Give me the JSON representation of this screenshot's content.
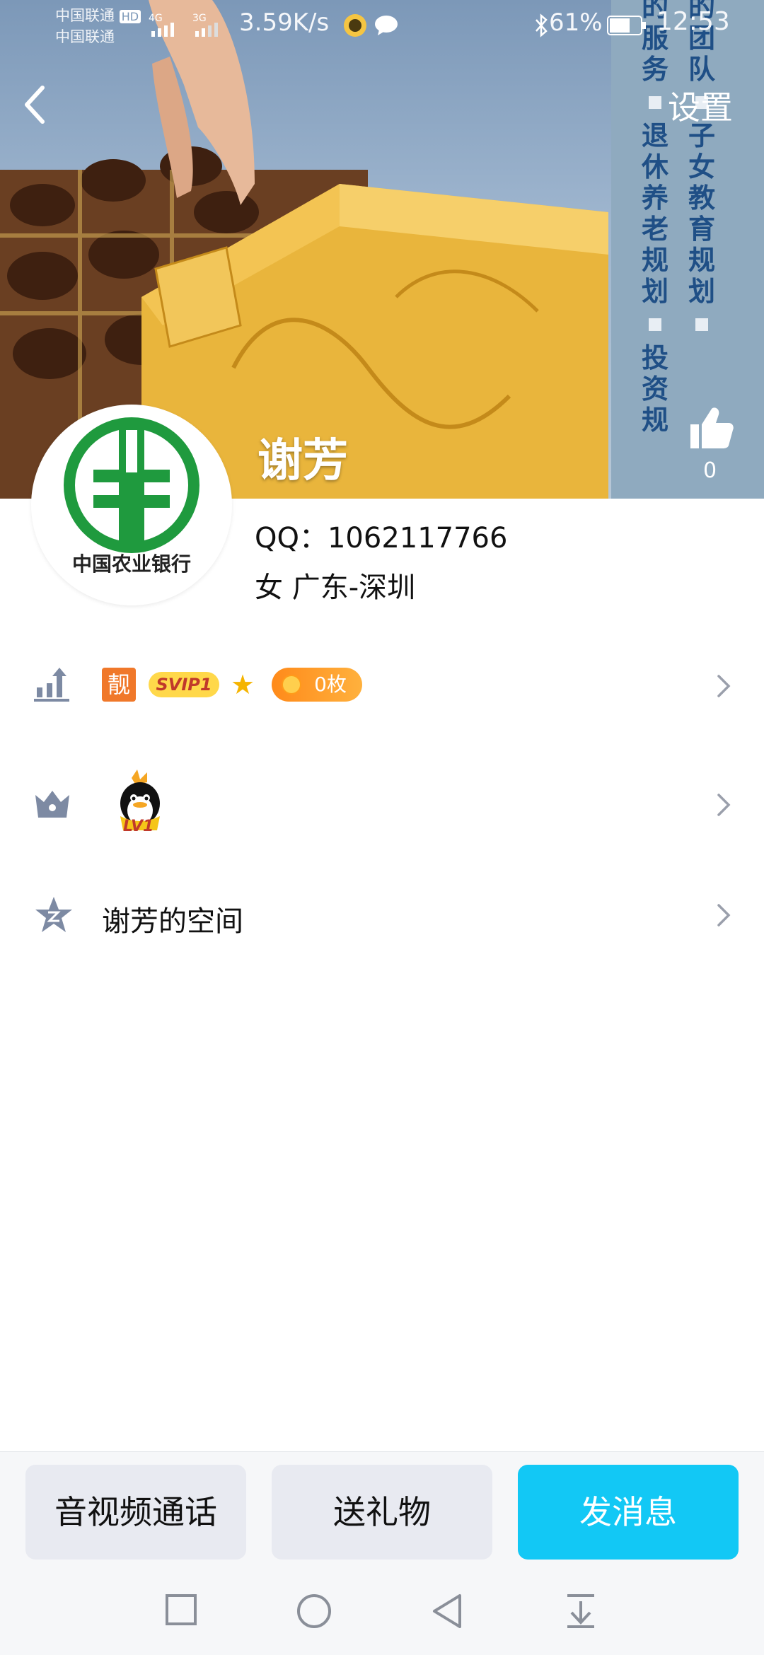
{
  "status_bar": {
    "carrier_1": "中国联通",
    "carrier_2": "中国联通",
    "hd_label": "HD",
    "net_1": "4G",
    "net_2": "3G",
    "speed": "3.59K/s",
    "battery": "61%",
    "time": "12:53"
  },
  "header": {
    "back_icon": "chevron-left-icon",
    "settings_label": "设置",
    "like_count": "0",
    "banner_columns": [
      {
        "top": "的服务",
        "bottom": "退休养老规划",
        "tail": "投资规"
      },
      {
        "top": "的团队",
        "bottom": "子女教育规划",
        "tail": ""
      }
    ]
  },
  "profile": {
    "name": "谢芳",
    "qq": "QQ：1062117766",
    "gender_location": "女  广东-深圳",
    "avatar_text": "中国农业银行"
  },
  "rows": [
    {
      "icon": "level-up-icon",
      "badges": {
        "liang": "靓",
        "svip": "SVIP1",
        "coin": "0枚"
      }
    },
    {
      "icon": "crown-icon",
      "badge_text": "LV1"
    },
    {
      "icon": "qzone-star-icon",
      "label": "谢芳的空间"
    }
  ],
  "actions": {
    "call": "音视频通话",
    "gift": "送礼物",
    "message": "发消息"
  },
  "colors": {
    "primary": "#12c8f5",
    "secondary_btn": "#e8eaf1",
    "banner_text": "#1f4f86"
  }
}
